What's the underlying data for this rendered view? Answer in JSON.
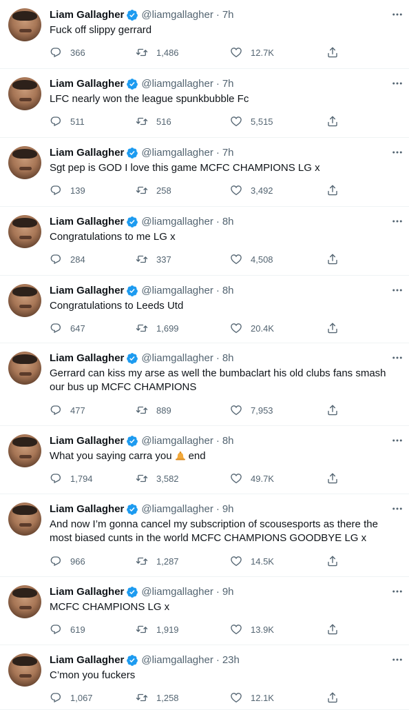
{
  "author": {
    "name": "Liam Gallagher",
    "handle": "@liamgallagher"
  },
  "colors": {
    "verified": "#1d9bf0",
    "muted": "#536471",
    "text": "#0f1419",
    "divider": "#eff3f4"
  },
  "tweets": [
    {
      "time": "7h",
      "text": "Fuck off slippy gerrard",
      "replies": "366",
      "retweets": "1,486",
      "likes": "12.7K"
    },
    {
      "time": "7h",
      "text": "LFC nearly won the league spunkbubble Fc",
      "replies": "511",
      "retweets": "516",
      "likes": "5,515"
    },
    {
      "time": "7h",
      "text": "Sgt pep is GOD I love this game MCFC CHAMPIONS LG x",
      "replies": "139",
      "retweets": "258",
      "likes": "3,492"
    },
    {
      "time": "8h",
      "text": "Congratulations to me LG x",
      "replies": "284",
      "retweets": "337",
      "likes": "4,508"
    },
    {
      "time": "8h",
      "text": "Congratulations to Leeds Utd",
      "replies": "647",
      "retweets": "1,699",
      "likes": "20.4K"
    },
    {
      "time": "8h",
      "text": "Gerrard can kiss my arse as well the bumbaclart his old clubs fans smash our bus up MCFC CHAMPIONS",
      "replies": "477",
      "retweets": "889",
      "likes": "7,953"
    },
    {
      "time": "8h",
      "text_before": "What you saying carra you",
      "text_after": "end",
      "emoji": "bell-emoji",
      "replies": "1,794",
      "retweets": "3,582",
      "likes": "49.7K"
    },
    {
      "time": "9h",
      "text": "And now I’m gonna cancel my  subscription of scousesports as there the most biased cunts in the world MCFC CHAMPIONS GOODBYE LG x",
      "replies": "966",
      "retweets": "1,287",
      "likes": "14.5K"
    },
    {
      "time": "9h",
      "text": "MCFC CHAMPIONS LG x",
      "replies": "619",
      "retweets": "1,919",
      "likes": "13.9K"
    },
    {
      "time": "23h",
      "text": "C’mon you fuckers",
      "replies": "1,067",
      "retweets": "1,258",
      "likes": "12.1K"
    }
  ]
}
